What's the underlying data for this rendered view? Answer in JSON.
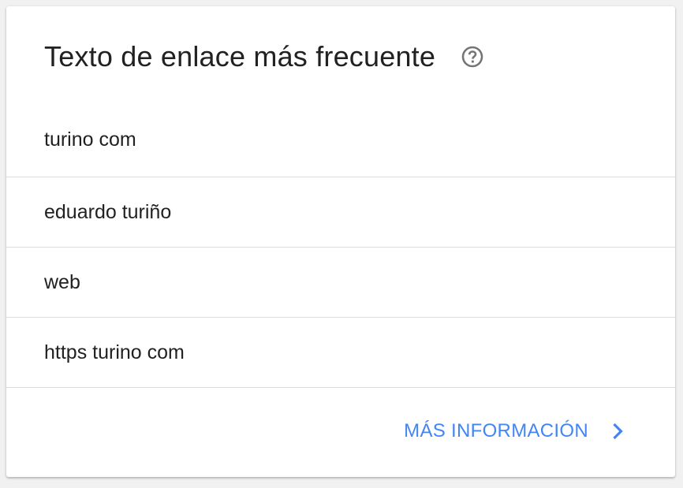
{
  "card": {
    "title": "Texto de enlace más frecuente",
    "help_icon": "help-circle-icon",
    "items": [
      {
        "label": "turino com"
      },
      {
        "label": "eduardo turiño"
      },
      {
        "label": "web"
      },
      {
        "label": "https turino com"
      }
    ],
    "more_link_label": "MÁS INFORMACIÓN",
    "more_link_icon": "chevron-right-icon"
  },
  "colors": {
    "accent": "#4285f4",
    "text": "#212121",
    "divider": "#dcdcdc",
    "icon": "#757575"
  }
}
